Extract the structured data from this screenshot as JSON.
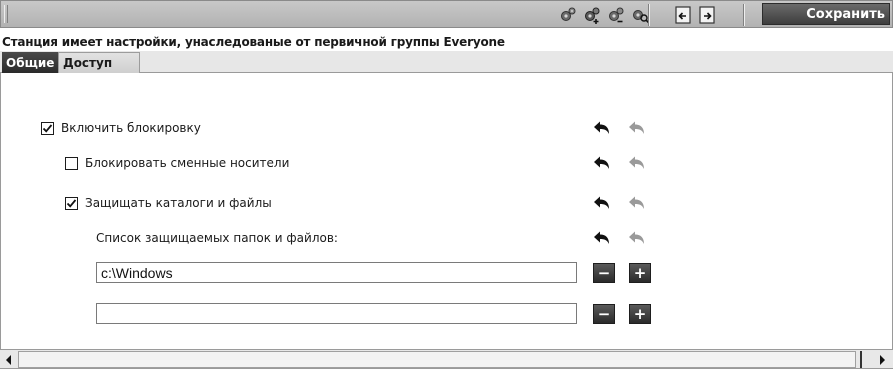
{
  "toolbar": {
    "icons_group1": [
      "gears-icon",
      "gears-add-icon",
      "gears-remove-icon",
      "gears-search-icon"
    ],
    "icons_group2": [
      "page-import-icon",
      "page-export-icon"
    ],
    "save_label": "Сохранить"
  },
  "inherit_note": "Станция имеет настройки, унаследованые от первичной группы Everyone",
  "tabs": [
    {
      "label": "Общие",
      "active": true
    },
    {
      "label": "Доступ",
      "active": false
    }
  ],
  "settings": {
    "enable_lock": {
      "label": "Включить блокировку",
      "checked": true
    },
    "block_removable": {
      "label": "Блокировать сменные носители",
      "checked": false
    },
    "protect_dirs": {
      "label": "Защищать каталоги и файлы",
      "checked": true
    },
    "protected_list_label": "Список защищаемых папок и файлов:"
  },
  "protected_paths": [
    {
      "value": "c:\\Windows"
    },
    {
      "value": ""
    }
  ],
  "buttons": {
    "remove_symbol": "−",
    "add_symbol": "+"
  },
  "colors": {
    "accent_dark": "#2a2a2a",
    "toolbar_bg": "#bdbdbd",
    "save_text": "#ffffff"
  }
}
